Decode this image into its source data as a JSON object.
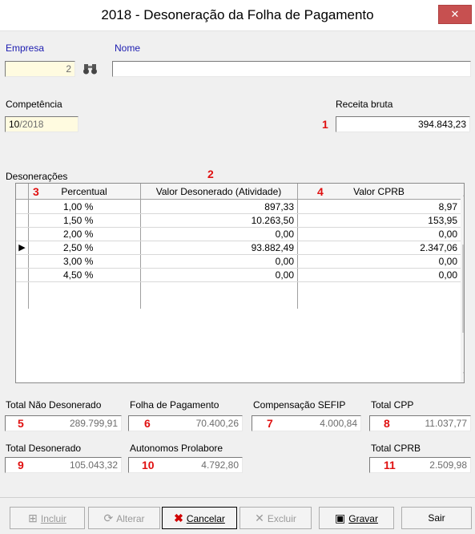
{
  "window": {
    "title": "2018 - Desoneração da Folha de Pagamento",
    "close_glyph": "✕"
  },
  "empresa": {
    "label": "Empresa",
    "value": "2",
    "nome_label": "Nome",
    "nome_value": ""
  },
  "competencia": {
    "label": "Competência",
    "value_month": "10",
    "value_year": "/2018"
  },
  "receita": {
    "label": "Receita bruta",
    "value": "394.843,23"
  },
  "desoneracoes": {
    "label": "Desonerações",
    "headers": [
      "Percentual",
      "Valor Desonerado (Atividade)",
      "Valor CPRB"
    ],
    "rows": [
      {
        "percent": "1,00 %",
        "desonerado": "897,33",
        "cprb": "8,97"
      },
      {
        "percent": "1,50 %",
        "desonerado": "10.263,50",
        "cprb": "153,95"
      },
      {
        "percent": "2,00 %",
        "desonerado": "0,00",
        "cprb": "0,00"
      },
      {
        "percent": "2,50 %",
        "desonerado": "93.882,49",
        "cprb": "2.347,06"
      },
      {
        "percent": "3,00 %",
        "desonerado": "0,00",
        "cprb": "0,00"
      },
      {
        "percent": "4,50 %",
        "desonerado": "0,00",
        "cprb": "0,00"
      }
    ],
    "current_row_marker": "▶"
  },
  "totals": {
    "nao_desonerado": {
      "label": "Total Não Desonerado",
      "value": "289.799,91"
    },
    "folha": {
      "label": "Folha de Pagamento",
      "value": "70.400,26"
    },
    "compensacao": {
      "label": "Compensação SEFIP",
      "value": "4.000,84"
    },
    "total_cpp": {
      "label": "Total CPP",
      "value": "11.037,77"
    },
    "total_desonerado": {
      "label": "Total Desonerado",
      "value": "105.043,32"
    },
    "autonomos": {
      "label": "Autonomos Prolabore",
      "value": "4.792,80"
    },
    "total_cprb": {
      "label": "Total CPRB",
      "value": "2.509,98"
    }
  },
  "annotations": [
    "1",
    "2",
    "3",
    "4",
    "5",
    "6",
    "7",
    "8",
    "9",
    "10",
    "11"
  ],
  "buttons": {
    "incluir": "Incluir",
    "alterar": "Alterar",
    "cancelar": "Cancelar",
    "excluir": "Excluir",
    "gravar": "Gravar",
    "sair": "Sair"
  },
  "colors": {
    "annotation": "#e01010",
    "label_blue": "#1c1cb0"
  }
}
